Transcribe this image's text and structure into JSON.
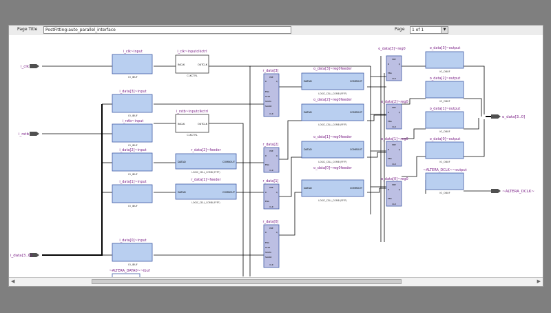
{
  "toolbar": {
    "page_title_label": "Page Title",
    "page_title_value": "PostFitting:auto_parallel_interface",
    "page_label": "Page",
    "page_value": "1 of 1"
  },
  "colors": {
    "block_fill": "#b9cff0",
    "block_stroke": "#3e5aa5",
    "reg_fill": "#bcbfe3",
    "port": "#505050",
    "label": "#7a1f86",
    "wire": "#000000"
  },
  "ports": [
    {
      "label": "i_clk"
    },
    {
      "label": "i_rstb"
    },
    {
      "label": "i_data[3..0]"
    },
    {
      "label": "o_data[3..0]"
    },
    {
      "label": "~ALTERA_DCLK~"
    }
  ],
  "io_buffers": [
    {
      "title": "i_clk~input",
      "type": "IO_IBUF"
    },
    {
      "title": "i_data[3]~input",
      "type": "IO_IBUF"
    },
    {
      "title": "i_rstb~input",
      "type": "IO_IBUF"
    },
    {
      "title": "i_data[2]~input",
      "type": "IO_IBUF"
    },
    {
      "title": "i_data[1]~input",
      "type": "IO_IBUF"
    },
    {
      "title": "i_data[0]~input",
      "type": "IO_IBUF"
    },
    {
      "title": "~ALTERA_DATA0~~ibuf",
      "type": ""
    }
  ],
  "clkctrl": [
    {
      "title": "i_clk~inputclkctrl",
      "pins": [
        "INCLK",
        "OUTCLK"
      ],
      "type": "CLKCTRL"
    },
    {
      "title": "i_rstb~inputclkctrl",
      "pins": [
        "INCLK",
        "OUTCLK"
      ],
      "type": "CLKCTRL"
    }
  ],
  "feeders": [
    {
      "title": "r_data[2]~feeder",
      "pins": [
        "DATAD",
        "COMBOUT"
      ],
      "type": "LOGIC_CELL_COMB (FFFF)"
    },
    {
      "title": "r_data[1]~feeder",
      "pins": [
        "DATAD",
        "COMBOUT"
      ],
      "type": "LOGIC_CELL_COMB (FFFF)"
    },
    {
      "title": "o_data[3]~reg0feeder",
      "pins": [
        "DATAD",
        "COMBOUT"
      ],
      "type": "LOGIC_CELL_COMB (FFFF)"
    },
    {
      "title": "o_data[2]~reg0feeder",
      "pins": [
        "DATAD",
        "COMBOUT"
      ],
      "type": "LOGIC_CELL_COMB (FFFF)"
    },
    {
      "title": "o_data[1]~reg0feeder",
      "pins": [
        "DATAD",
        "COMBOUT"
      ],
      "type": "LOGIC_CELL_COMB (FFFF)"
    },
    {
      "title": "o_data[0]~reg0feeder",
      "pins": [
        "DATAD",
        "COMBOUT"
      ],
      "type": "LOGIC_CELL_COMB (FFFF)"
    }
  ],
  "registers": [
    {
      "title": "r_data[3]",
      "pins": [
        "PRE",
        "D",
        "Q",
        "ENA",
        "SCLR",
        "SDATA",
        "SLOAD",
        "CLR"
      ]
    },
    {
      "title": "r_data[2]",
      "pins": [
        "PRE",
        "D",
        "Q",
        "ENA",
        "CLR"
      ]
    },
    {
      "title": "r_data[1]",
      "pins": [
        "PRE",
        "D",
        "Q",
        "ENA",
        "CLR"
      ]
    },
    {
      "title": "r_data[0]",
      "pins": [
        "PRE",
        "D",
        "Q",
        "ENA",
        "SCLR",
        "SDATA",
        "SLOAD",
        "CLR"
      ]
    },
    {
      "title": "o_data[3]~reg0",
      "pins": [
        "PRE",
        "D",
        "Q",
        "ENA",
        "CLR"
      ]
    },
    {
      "title": "o_data[2]~reg0",
      "pins": [
        "PRE",
        "D",
        "Q",
        "ENA",
        "CLR"
      ]
    },
    {
      "title": "o_data[1]~reg0",
      "pins": [
        "PRE",
        "D",
        "Q",
        "ENA",
        "CLR"
      ]
    },
    {
      "title": "o_data[0]~reg0",
      "pins": [
        "PRE",
        "D",
        "Q",
        "ENA",
        "CLR"
      ]
    }
  ],
  "output_buffers": [
    {
      "title": "o_data[3]~output",
      "type": "IO_OBUF"
    },
    {
      "title": "o_data[2]~output",
      "type": "IO_OBUF"
    },
    {
      "title": "o_data[1]~output",
      "type": "IO_OBUF"
    },
    {
      "title": "o_data[0]~output",
      "type": "IO_OBUF"
    },
    {
      "title": "~ALTERA_DCLK~~output",
      "type": "IO_OBUF"
    }
  ]
}
